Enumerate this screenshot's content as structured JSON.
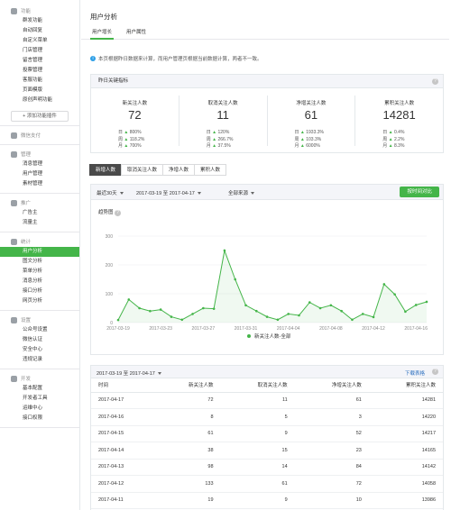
{
  "sidebar": {
    "groups": [
      {
        "title": "功能",
        "items": [
          "群发功能",
          "自动回复",
          "自定义菜单",
          "门店管理",
          "留言管理",
          "投票管理",
          "客服功能",
          "页面模版",
          "原创声明功能"
        ]
      },
      {
        "title": "微信支付",
        "items": []
      },
      {
        "title": "管理",
        "items": [
          "消息管理",
          "用户管理",
          "素材管理"
        ]
      },
      {
        "title": "推广",
        "items": [
          "广告主",
          "流量主"
        ]
      },
      {
        "title": "统计",
        "items": [
          "用户分析",
          "图文分析",
          "菜单分析",
          "消息分析",
          "接口分析",
          "网页分析"
        ]
      },
      {
        "title": "设置",
        "items": [
          "公众号设置",
          "微信认证",
          "安全中心",
          "违规记录"
        ]
      },
      {
        "title": "开发",
        "items": [
          "基本配置",
          "开发者工具",
          "运维中心",
          "接口权限"
        ]
      }
    ],
    "add_plugin": "+ 添加功能插件",
    "active_item": "用户分析"
  },
  "page": {
    "title": "用户分析",
    "tabs": [
      "用户增长",
      "用户属性"
    ],
    "notice": "本页根据昨日数据来计算，而用户管理页根据当前数据计算，两者不一致。"
  },
  "kpi": {
    "header": "昨日关键指标",
    "cards": [
      {
        "label": "新关注人数",
        "value": "72",
        "rows": [
          [
            "日",
            "800%"
          ],
          [
            "周",
            "118.2%"
          ],
          [
            "月",
            "700%"
          ]
        ]
      },
      {
        "label": "取消关注人数",
        "value": "11",
        "rows": [
          [
            "日",
            "120%"
          ],
          [
            "周",
            "266.7%"
          ],
          [
            "月",
            "37.5%"
          ]
        ]
      },
      {
        "label": "净增关注人数",
        "value": "61",
        "rows": [
          [
            "日",
            "1933.3%"
          ],
          [
            "周",
            "103.3%"
          ],
          [
            "月",
            "6000%"
          ]
        ]
      },
      {
        "label": "累积关注人数",
        "value": "14281",
        "rows": [
          [
            "日",
            "0.4%"
          ],
          [
            "周",
            "2.2%"
          ],
          [
            "月",
            "8.3%"
          ]
        ]
      }
    ]
  },
  "filter_tabs": [
    "新增人数",
    "取消关注人数",
    "净增人数",
    "累积人数"
  ],
  "chart_toolbar": {
    "period": "最近30天",
    "range": "2017-03-19 至 2017-04-17",
    "source": "全部来源",
    "export": "按时间对比"
  },
  "chart_data": {
    "type": "line",
    "title": "趋势图",
    "x": [
      "2017-03-19",
      "2017-03-20",
      "2017-03-21",
      "2017-03-22",
      "2017-03-23",
      "2017-03-24",
      "2017-03-25",
      "2017-03-26",
      "2017-03-27",
      "2017-03-28",
      "2017-03-29",
      "2017-03-30",
      "2017-03-31",
      "2017-04-01",
      "2017-04-02",
      "2017-04-03",
      "2017-04-04",
      "2017-04-05",
      "2017-04-06",
      "2017-04-07",
      "2017-04-08",
      "2017-04-09",
      "2017-04-10",
      "2017-04-11",
      "2017-04-12",
      "2017-04-13",
      "2017-04-14",
      "2017-04-15",
      "2017-04-16",
      "2017-04-17"
    ],
    "xticks": [
      "2017-03-19",
      "2017-03-23",
      "2017-03-27",
      "2017-03-31",
      "2017-04-04",
      "2017-04-08",
      "2017-04-12",
      "2017-04-16"
    ],
    "series": [
      {
        "name": "新关注人数-全部",
        "values": [
          9,
          80,
          50,
          40,
          45,
          20,
          10,
          30,
          50,
          48,
          250,
          150,
          60,
          40,
          20,
          10,
          30,
          25,
          70,
          50,
          60,
          40,
          10,
          30,
          19,
          133,
          98,
          38,
          61,
          72
        ]
      }
    ],
    "ylim": [
      0,
      300
    ],
    "yticks": [
      0,
      100,
      200,
      300
    ],
    "color": "#44b549"
  },
  "table": {
    "range": "2017-03-19 至 2017-04-17",
    "download": "下载表格",
    "columns": [
      "时间",
      "新关注人数",
      "取消关注人数",
      "净增关注人数",
      "累积关注人数"
    ],
    "rows": [
      [
        "2017-04-17",
        "72",
        "11",
        "61",
        "14281"
      ],
      [
        "2017-04-16",
        "8",
        "5",
        "3",
        "14220"
      ],
      [
        "2017-04-15",
        "61",
        "9",
        "52",
        "14217"
      ],
      [
        "2017-04-14",
        "38",
        "15",
        "23",
        "14165"
      ],
      [
        "2017-04-13",
        "98",
        "14",
        "84",
        "14142"
      ],
      [
        "2017-04-12",
        "133",
        "61",
        "72",
        "14058"
      ],
      [
        "2017-04-11",
        "19",
        "9",
        "10",
        "13986"
      ]
    ]
  }
}
